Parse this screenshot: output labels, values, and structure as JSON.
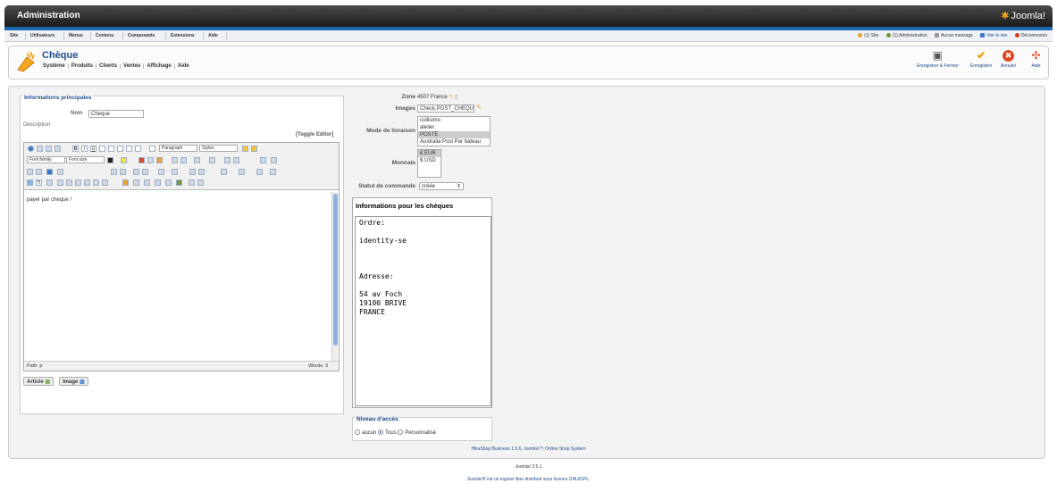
{
  "header": {
    "title": "Administration",
    "logo": "Joomla!"
  },
  "menu": [
    "Site",
    "Utilisateurs",
    "Menus",
    "Contenu",
    "Composants",
    "Extensions",
    "Aide"
  ],
  "status": {
    "site": "(1) Site",
    "admin": "(1) Administration",
    "messages": "Aucun message",
    "view_site": "Voir le site",
    "logout": "Déconnexion"
  },
  "page": {
    "title": "Chèque",
    "submenu": [
      "Système",
      "Produits",
      "Clients",
      "Ventes",
      "Affichage",
      "Aide"
    ]
  },
  "toolbar": {
    "save_close": "Enregistrer & Fermer",
    "save": "Enregistrer",
    "cancel": "Annuler",
    "help": "Aide"
  },
  "main": {
    "legend": "Informations principales",
    "name_label": "Nom",
    "name_value": "Cheque",
    "desc_label": "Description",
    "toggle": "[Toggle Editor]",
    "editor": {
      "paragraph": "Paragraph",
      "styles": "Styles",
      "font_family": "Font family",
      "font_size": "Font size",
      "content": "payer par cheque !",
      "path": "Path: p",
      "words": "Words: 3"
    },
    "btn_article": "Article",
    "btn_image": "Image"
  },
  "right": {
    "zone_label": "Zone",
    "zone_value": "4507 France",
    "images_label": "Images",
    "images_value": "Check,POST_CHEQUI",
    "shipping_label": "Mode de livraison",
    "shipping_options": [
      "collisimo",
      "atelier",
      "POSTE",
      "Australia Post Par bateau"
    ],
    "currency_label": "Monnaie",
    "currency_options": [
      "€ EUR",
      "$ USD"
    ],
    "order_status_label": "Statut de commande",
    "order_status_value": "créée",
    "info_title": "Informations pour les chèques",
    "info_text": "Ordre:\n\nidentity-se\n\n\n\nAdresse:\n\n54 av Foch\n19100 BRIVE\nFRANCE",
    "access_legend": "Niveau d'accès",
    "access_options": [
      "aucun",
      "Tous",
      "Personnalisé"
    ]
  },
  "footer": {
    "product": "HikaShop Business 1.5.6, Joomla!™ Online Shop System",
    "version": "Joomla! 2.5.1",
    "license": "Joomla!® est un logiciel libre distribué sous licence GNU/GPL."
  }
}
